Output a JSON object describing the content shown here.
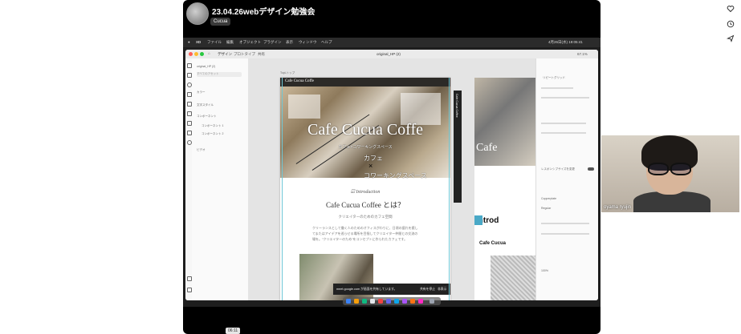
{
  "meeting": {
    "title": "23.04.26webデザイン勉強会",
    "channel_badge": "Cucua",
    "timer": "06:11",
    "participant_name": "oyama ryujin"
  },
  "mac_menubar": {
    "app_name": "XD",
    "items": [
      "ファイル",
      "編集",
      "オブジェクト",
      "プラグイン",
      "表示",
      "ウィンドウ",
      "ヘルプ"
    ],
    "clock": "4月26日(水) 19:05:41"
  },
  "xd": {
    "tabs": [
      "デザイン",
      "プロトタイプ",
      "共有"
    ],
    "document_title": "original_HP (2)",
    "zoom": "67.1%",
    "search_placeholder": "すべてのアセット",
    "layers_sections": [
      "カラー",
      "文字スタイル",
      "コンポーネント"
    ],
    "layer_items": [
      "コンポーネント 1",
      "コンポーネント 2"
    ],
    "layers_bottom": "ビデオ",
    "artboard_label": "TopLトップ",
    "right_panel_heading": "リピートグリッド",
    "responsive_label": "レスポンシブサイズを変更",
    "font_name": "Copperplate",
    "font_style": "Regular",
    "opacity": "100%"
  },
  "site": {
    "header_logo": "Cafe Cucua Coffe",
    "hero_title": "Cafe Cucua Coffe",
    "hero_subtitle": "カフェ×コワーキングスペース",
    "hero_cafe": "カフェ",
    "hero_x": "×",
    "hero_cowork": "コワーキングスペース",
    "intro_label": "Introduction",
    "intro_title": "Cafe Cucua Coffee とは？",
    "intro_caption": "クリエイターのためのカフェ空間",
    "intro_body": "クリーランスとして働く人のためのオフィスがわりに、日頃の疲れを癒してまたはアイデアを巡らせる場所を目指してクリエイター仲間との交流の場を。”クリエイターのため”をコンセプトに作られたカフェです。",
    "side_label_a": "Cafe Cucua Coffee",
    "side_label_b": "Introd",
    "side_label_c": "Cafe Cucua",
    "side_label_d": "Cafe",
    "toast": "meet.google.com が画面を共有しています。",
    "toast_btn_stop": "共有を停止",
    "toast_btn_hide": "非表示"
  }
}
